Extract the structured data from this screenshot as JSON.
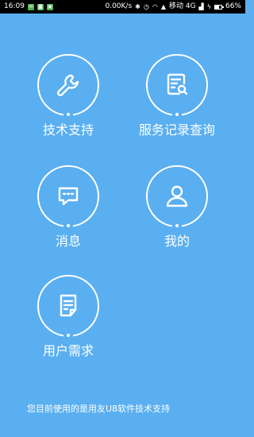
{
  "status_bar": {
    "time": "16:09",
    "notification_icons": [
      "sms-icon",
      "chat-icon",
      "app-icon"
    ],
    "net_speed": "0.00K/s",
    "carrier": "移动 4G",
    "battery": "66%"
  },
  "menu": {
    "items": [
      {
        "label": "技术支持",
        "icon": "wrench-icon"
      },
      {
        "label": "服务记录查询",
        "icon": "document-search-icon"
      },
      {
        "label": "消息",
        "icon": "message-icon"
      },
      {
        "label": "我的",
        "icon": "user-icon"
      },
      {
        "label": "用户需求",
        "icon": "document-edit-icon"
      }
    ]
  },
  "footer": {
    "text": "您目前使用的是用友U8软件技术支持"
  },
  "colors": {
    "background": "#5aaff0",
    "foreground": "#ffffff",
    "status_bar": "#000000"
  }
}
